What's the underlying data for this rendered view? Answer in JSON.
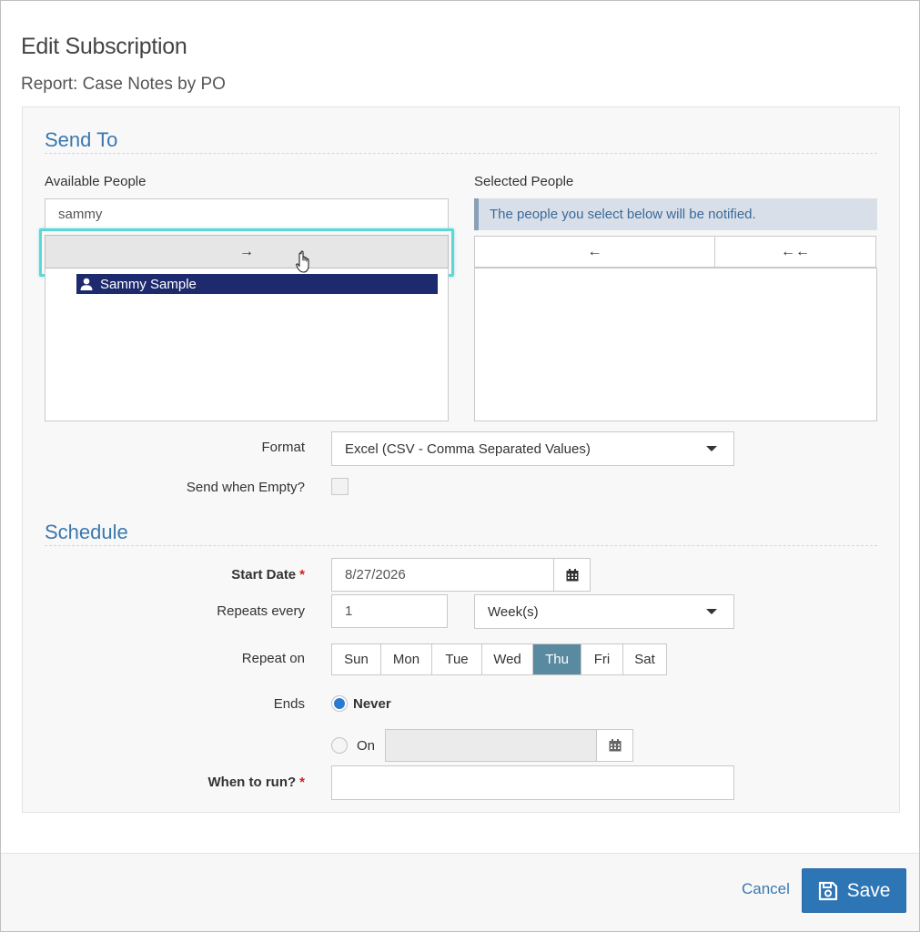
{
  "dialog": {
    "title": "Edit Subscription",
    "subtitle": "Report: Case Notes by PO"
  },
  "send_to": {
    "section_title": "Send To",
    "available": {
      "label": "Available People",
      "search_value": "sammy",
      "move_right_glyph": "→",
      "items": [
        {
          "name": "Sammy Sample",
          "icon": "person-icon",
          "selected": true
        }
      ]
    },
    "selected": {
      "label": "Selected People",
      "notice": "The people you select below will be notified.",
      "move_left_glyph": "←",
      "move_all_left_glyph": "←←",
      "items": []
    },
    "format": {
      "label": "Format",
      "value": "Excel (CSV - Comma Separated Values)"
    },
    "send_when_empty": {
      "label": "Send when Empty?",
      "checked": false
    }
  },
  "schedule": {
    "section_title": "Schedule",
    "start_date": {
      "label": "Start Date",
      "value": "8/27/2026",
      "required_mark": "*"
    },
    "repeats_every": {
      "label": "Repeats every",
      "value": "1",
      "unit": "Week(s)"
    },
    "repeat_on": {
      "label": "Repeat on",
      "days": [
        "Sun",
        "Mon",
        "Tue",
        "Wed",
        "Thu",
        "Fri",
        "Sat"
      ],
      "active": "Thu"
    },
    "ends": {
      "label": "Ends",
      "never_label": "Never",
      "on_label": "On",
      "selected": "Never",
      "on_date_value": ""
    },
    "when_to_run": {
      "label": "When to run?",
      "value": "",
      "required_mark": "*"
    }
  },
  "footer": {
    "cancel_label": "Cancel",
    "save_label": "Save"
  },
  "colors": {
    "accent": "#3a78b0",
    "primary_button": "#2e75b6",
    "selected_item": "#1e2a6e",
    "active_day": "#5a8aa0",
    "highlight": "#5fd6d6",
    "required": "#d01f1f"
  }
}
